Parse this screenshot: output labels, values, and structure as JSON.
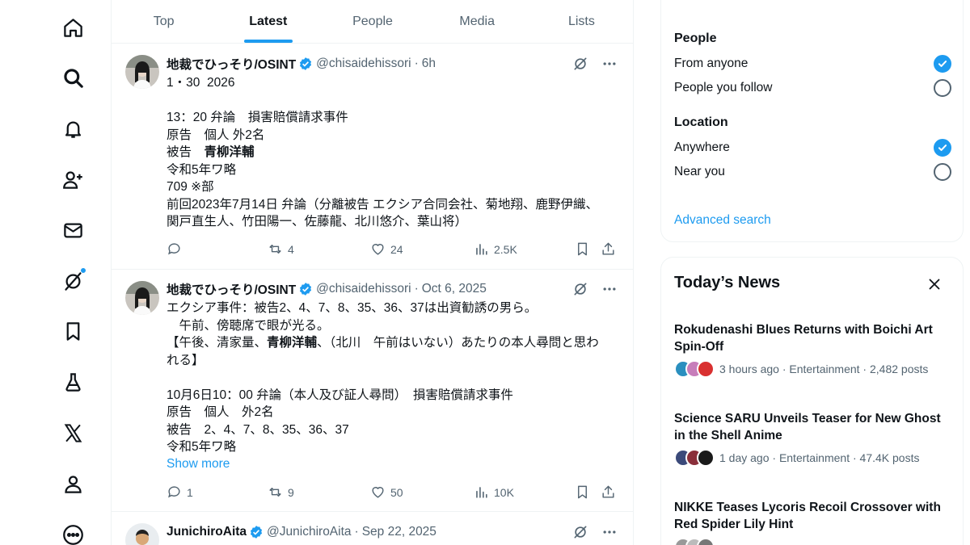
{
  "nav": {
    "items": [
      "home",
      "explore",
      "notifications",
      "communities",
      "messages",
      "grok",
      "bookmarks",
      "labs",
      "x-premium",
      "profile",
      "more"
    ]
  },
  "tabs": [
    {
      "label": "Top"
    },
    {
      "label": "Latest"
    },
    {
      "label": "People"
    },
    {
      "label": "Media"
    },
    {
      "label": "Lists"
    }
  ],
  "posts": [
    {
      "author": "地裁でひっそり/OSINT",
      "handle": "@chisaidehissori",
      "time": "6h",
      "lines": [
        "1・30  2026",
        "",
        "13：20 弁論　損害賠償請求事件",
        "原告　個人 外2名",
        "被告　",
        "令和5年ワ略",
        "709 ※部",
        "前回2023年7月14日 弁論（分離被告 エクシア合同会社、菊地翔、鹿野伊織、",
        "関戸直生人、竹田陽一、佐藤龍、北川悠介、葉山将）"
      ],
      "bold_name": "青柳洋輔",
      "replies": "",
      "reposts": "4",
      "likes": "24",
      "views": "2.5K"
    },
    {
      "author": "地裁でひっそり/OSINT",
      "handle": "@chisaidehissori",
      "time": "Oct 6, 2025",
      "line1": "エクシア事件：被告2、4、7、8、35、36、37は出資勧誘の男ら。",
      "line2": "　午前、傍聴席で眼が光る。",
      "line3a": "【午後、清家量、",
      "bold_name": "青柳洋輔",
      "line3b": "、（北川　午前はいない）あたりの本人尋問と思わ",
      "line4": "れる】",
      "line5": "",
      "line6": "10月6日10：00 弁論（本人及び証人尋問）　損害賠償請求事件",
      "line7": "原告　個人　外2名",
      "line8": "被告　2、4、7、8、35、36、37",
      "line9": "令和5年ワ略",
      "show_more": "Show more",
      "replies": "1",
      "reposts": "9",
      "likes": "50",
      "views": "10K"
    },
    {
      "author": "JunichiroAita",
      "handle": "@JunichiroAita",
      "time": "Sep 22, 2025"
    }
  ],
  "filters": {
    "people_title": "People",
    "people_options": [
      {
        "label": "From anyone",
        "checked": true
      },
      {
        "label": "People you follow",
        "checked": false
      }
    ],
    "location_title": "Location",
    "location_options": [
      {
        "label": "Anywhere",
        "checked": true
      },
      {
        "label": "Near you",
        "checked": false
      }
    ],
    "advanced": "Advanced search"
  },
  "news": {
    "title": "Today’s News",
    "items": [
      {
        "headline": "Rokudenashi Blues Returns with Boichi Art Spin-Off",
        "meta": "3 hours ago · Entertainment · 2,482 posts",
        "avatar_colors": [
          "#2a8fbf",
          "#c77dba",
          "#d93030"
        ]
      },
      {
        "headline": "Science SARU Unveils Teaser for New Ghost in the Shell Anime",
        "meta": "1 day ago · Entertainment · 47.4K posts",
        "avatar_colors": [
          "#3b4a7a",
          "#8a2f3a",
          "#1a1a1a"
        ]
      },
      {
        "headline": "NIKKE Teases Lycoris Recoil Crossover with Red Spider Lily Hint",
        "meta": "",
        "avatar_colors": [
          "#999999",
          "#bbbbbb",
          "#777777"
        ]
      }
    ]
  },
  "colors": {
    "accent": "#1d9bf0",
    "text": "#0f1419",
    "secondary": "#536471",
    "border": "#eff3f4"
  }
}
